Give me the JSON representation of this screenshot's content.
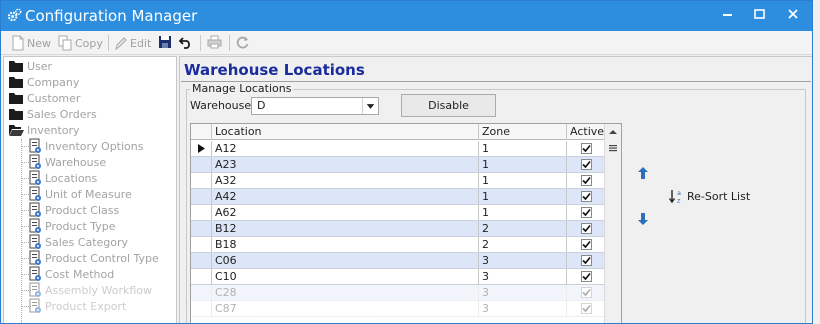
{
  "window": {
    "title": "Configuration Manager",
    "accent": "#2d8ee0"
  },
  "toolbar": {
    "new_label": "New",
    "copy_label": "Copy",
    "edit_label": "Edit"
  },
  "tree": {
    "items": [
      {
        "label": "User",
        "type": "folder"
      },
      {
        "label": "Company",
        "type": "folder"
      },
      {
        "label": "Customer",
        "type": "folder"
      },
      {
        "label": "Sales Orders",
        "type": "folder"
      },
      {
        "label": "Inventory",
        "type": "folder-open"
      },
      {
        "label": "Inventory Options",
        "type": "page"
      },
      {
        "label": "Warehouse",
        "type": "page"
      },
      {
        "label": "Locations",
        "type": "page"
      },
      {
        "label": "Unit of Measure",
        "type": "page"
      },
      {
        "label": "Product Class",
        "type": "page"
      },
      {
        "label": "Product Type",
        "type": "page"
      },
      {
        "label": "Sales Category",
        "type": "page"
      },
      {
        "label": "Product Control Type",
        "type": "page"
      },
      {
        "label": "Cost Method",
        "type": "page"
      },
      {
        "label": "Assembly Workflow",
        "type": "page"
      },
      {
        "label": "Product Export",
        "type": "page"
      }
    ]
  },
  "main": {
    "title": "Warehouse Locations",
    "group_label": "Manage Locations",
    "warehouse_label": "Warehouse",
    "warehouse_value": "D",
    "disable_label": "Disable",
    "resort_label": "Re-Sort List",
    "grid": {
      "columns": [
        "Location",
        "Zone",
        "Active"
      ],
      "rows": [
        {
          "location": "A12",
          "zone": "1",
          "active": true,
          "current": true
        },
        {
          "location": "A23",
          "zone": "1",
          "active": true
        },
        {
          "location": "A32",
          "zone": "1",
          "active": true
        },
        {
          "location": "A42",
          "zone": "1",
          "active": true
        },
        {
          "location": "A62",
          "zone": "1",
          "active": true
        },
        {
          "location": "B12",
          "zone": "2",
          "active": true
        },
        {
          "location": "B18",
          "zone": "2",
          "active": true
        },
        {
          "location": "C06",
          "zone": "3",
          "active": true
        },
        {
          "location": "C10",
          "zone": "3",
          "active": true
        },
        {
          "location": "C28",
          "zone": "3",
          "active": true
        },
        {
          "location": "C87",
          "zone": "3",
          "active": true
        }
      ]
    }
  }
}
